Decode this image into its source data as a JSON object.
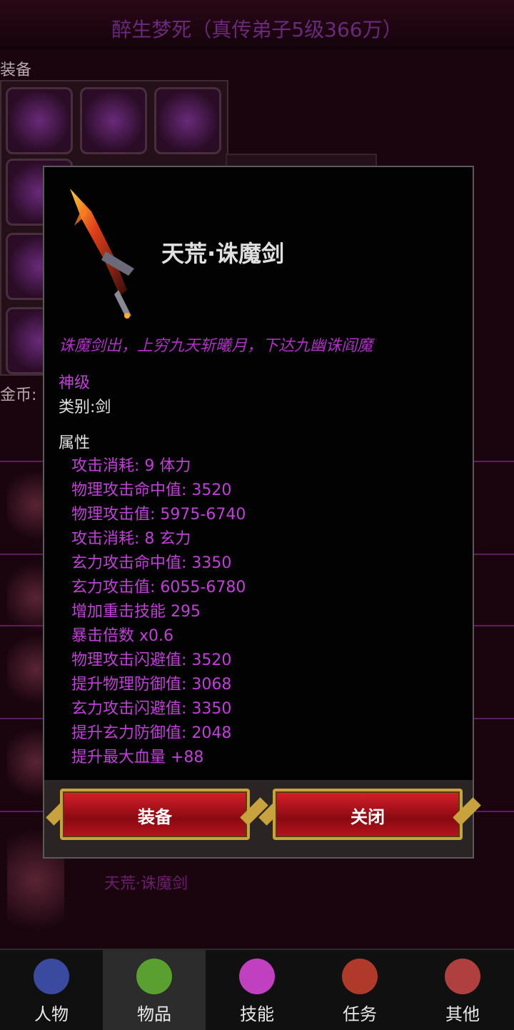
{
  "header": {
    "title": "醉生梦死（真传弟子5级366万）"
  },
  "equip_label": "装备",
  "gold_label": "金币:",
  "background_items": [
    "天荒·诛魔剑"
  ],
  "modal": {
    "item_name": "天荒·诛魔剑",
    "description": "诛魔剑出，上穷九天斩曦月，下达九幽诛阎魔",
    "rarity": "神级",
    "category": "类别:剑",
    "attributes_header": "属性",
    "attributes": [
      "攻击消耗: 9 体力",
      "物理攻击命中值: 3520",
      "物理攻击值:   5975-6740",
      "攻击消耗: 8 玄力",
      "玄力攻击命中值: 3350",
      "玄力攻击值:   6055-6780",
      "增加重击技能 295",
      "暴击倍数 x0.6",
      "物理攻击闪避值: 3520",
      "提升物理防御值:  3068",
      "玄力攻击闪避值: 3350",
      "提升玄力防御值:  2048",
      "提升最大血量 +88"
    ],
    "equip_button": "装备",
    "close_button": "关闭"
  },
  "tabs": [
    {
      "label": "人物",
      "icon": "character-icon",
      "color": "#3a4aa0"
    },
    {
      "label": "物品",
      "icon": "potion-icon",
      "color": "#5aa030"
    },
    {
      "label": "技能",
      "icon": "skill-orb-icon",
      "color": "#c040c0"
    },
    {
      "label": "任务",
      "icon": "quest-icon",
      "color": "#b03a2a"
    },
    {
      "label": "其他",
      "icon": "other-icon",
      "color": "#b04040"
    }
  ],
  "active_tab": "物品",
  "colors": {
    "accent_purple": "#c040d8",
    "button_red": "#c01420",
    "button_gold": "#c8a23c"
  }
}
